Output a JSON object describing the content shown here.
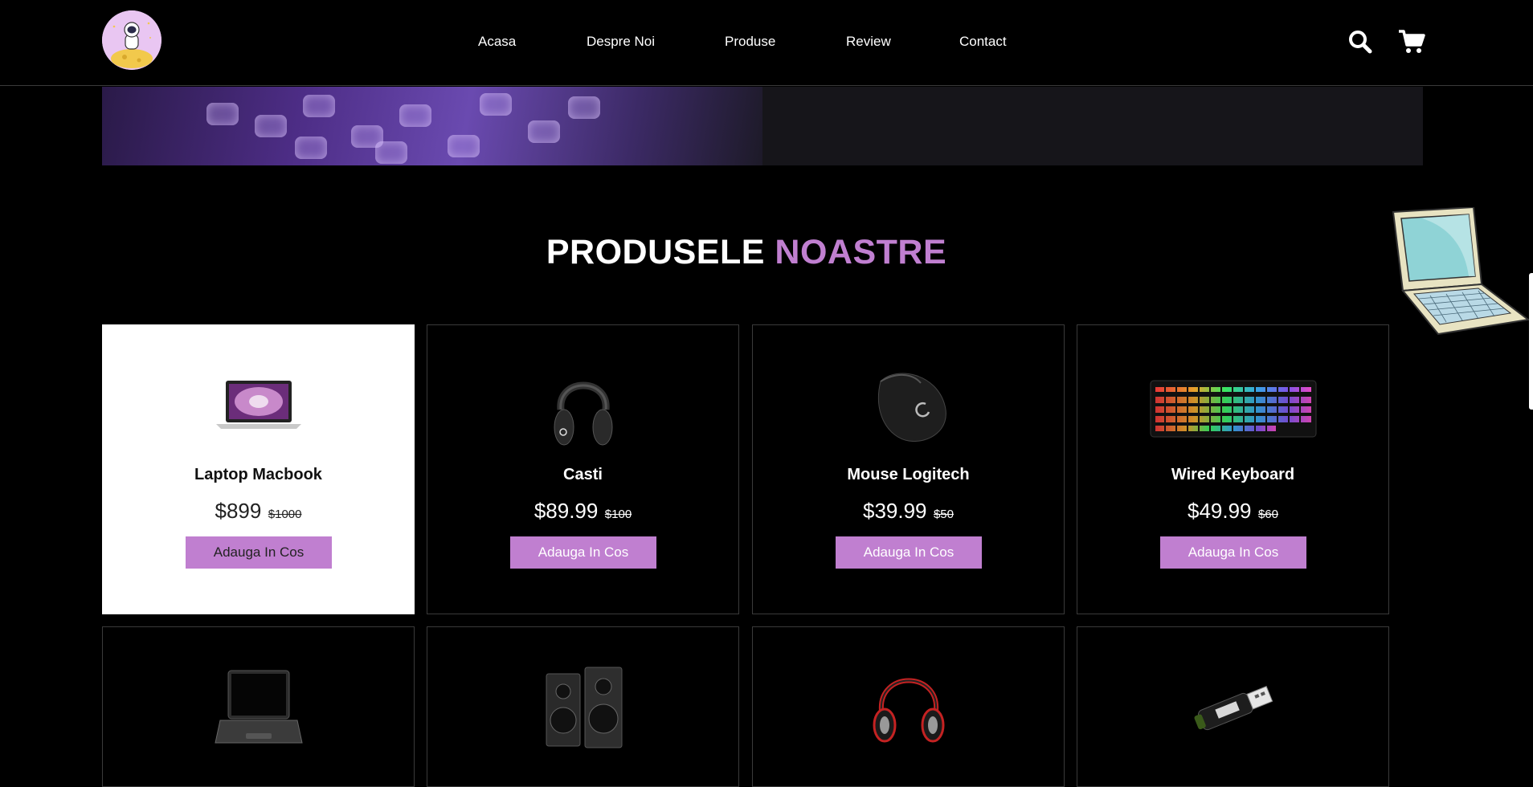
{
  "nav": {
    "items": [
      "Acasa",
      "Despre Noi",
      "Produse",
      "Review",
      "Contact"
    ]
  },
  "section": {
    "title_main": "PRODUSELE",
    "title_accent": "NOASTRE"
  },
  "products": [
    {
      "name": "Laptop Macbook",
      "price": "$899",
      "old_price": "$1000",
      "button": "Adauga In Cos",
      "icon": "laptop-macbook-icon"
    },
    {
      "name": "Casti",
      "price": "$89.99",
      "old_price": "$100",
      "button": "Adauga In Cos",
      "icon": "headphones-icon"
    },
    {
      "name": "Mouse Logitech",
      "price": "$39.99",
      "old_price": "$50",
      "button": "Adauga In Cos",
      "icon": "mouse-icon"
    },
    {
      "name": "Wired Keyboard",
      "price": "$49.99",
      "old_price": "$60",
      "button": "Adauga In Cos",
      "icon": "keyboard-icon"
    }
  ],
  "products_row2_icons": [
    "laptop-icon",
    "speakers-icon",
    "headset-icon",
    "usb-drive-icon"
  ],
  "colors": {
    "background": "#000000",
    "accent": "#c07fd0",
    "card_border": "#3a3a3a",
    "hover_card": "#ffffff"
  }
}
